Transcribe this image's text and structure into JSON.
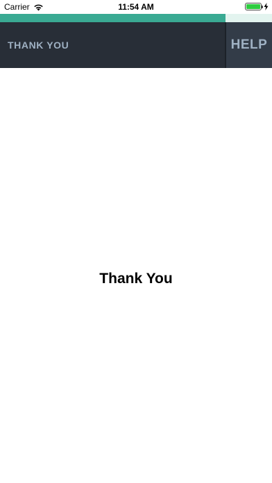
{
  "status_bar": {
    "carrier": "Carrier",
    "time": "11:54 AM",
    "battery_level": 1.0,
    "charging": true,
    "icons": [
      "wifi-icon",
      "battery-icon",
      "bolt-icon"
    ]
  },
  "progress": {
    "fraction": 0.83,
    "color": "#3aaa93",
    "track_color": "#e3f4ef"
  },
  "header": {
    "title": "THANK YOU",
    "help_label": "HELP",
    "background": "#282e37",
    "text_color": "#9fb1c3"
  },
  "main": {
    "message": "Thank You"
  }
}
